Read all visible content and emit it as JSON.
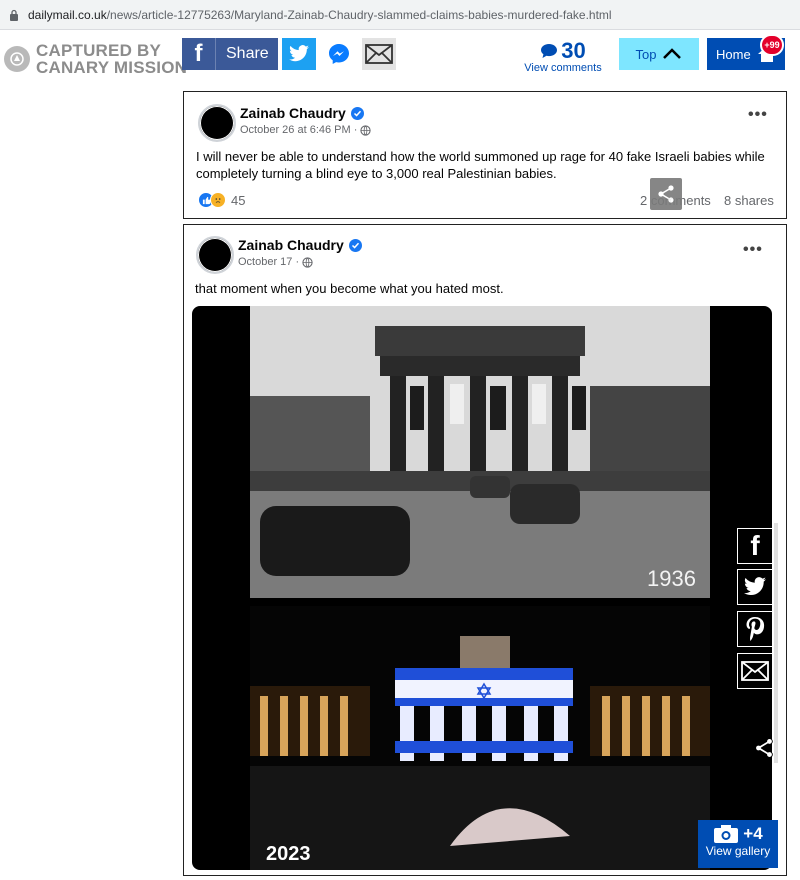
{
  "url": {
    "domain": "dailymail.co.uk",
    "path": "/news/article-12775263/Maryland-Zainab-Chaudry-slammed-claims-babies-murdered-fake.html"
  },
  "toolbar": {
    "canary_line1": "CAPTURED BY",
    "canary_line2": "CANARY MISSION",
    "share_label": "Share",
    "comment_count": "30",
    "view_comments": "View comments",
    "top_label": "Top",
    "home_label": "Home",
    "home_badge": "+99"
  },
  "post1": {
    "author": "Zainab Chaudry",
    "date": "October 26 at 6:46 PM ·",
    "text": "I will never be able to understand how the world summoned up rage for 40 fake Israeli babies while completely turning a blind eye to 3,000 real Palestinian babies.",
    "reactions": "45",
    "comments": "2 comments",
    "shares": "8 shares"
  },
  "post2": {
    "author": "Zainab Chaudry",
    "date": "October 17 ·",
    "text": "that moment when you become what you hated most.",
    "year_top": "1936",
    "year_bottom": "2023"
  },
  "gallery": {
    "count": "+4",
    "label": "View gallery"
  },
  "colors": {
    "facebook": "#3b5998",
    "twitter": "#1da1f2",
    "dm_blue": "#004db3",
    "top_cyan": "#7ee6ff",
    "badge_red": "#e4002b"
  },
  "icons": [
    "lock-icon",
    "canary-logo-icon",
    "facebook-icon",
    "twitter-icon",
    "messenger-icon",
    "email-icon",
    "comment-bubble-icon",
    "chevron-up-icon",
    "home-icon",
    "verified-icon",
    "globe-icon",
    "more-dots-icon",
    "like-icon",
    "sad-icon",
    "share-icon",
    "pinterest-icon",
    "camera-icon"
  ]
}
